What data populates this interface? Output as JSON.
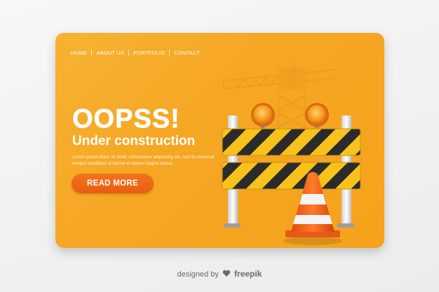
{
  "nav": {
    "items": [
      {
        "label": "HOME"
      },
      {
        "label": "ABOUT US"
      },
      {
        "label": "PORTFOLIO"
      },
      {
        "label": "CONTACT"
      }
    ]
  },
  "hero": {
    "headline": "OOPSS!",
    "subheadline": "Under construction",
    "body_text": "Lorem ipsum dolor sit amet, consectetur adipiscing elit, sed do eiusmod tempor incididunt ut labore et dolore magna aliqua.",
    "cta_label": "READ MORE"
  },
  "illustration": {
    "icons": [
      "construction-crane-icon",
      "warning-light-icon",
      "barricade-icon",
      "traffic-cone-icon"
    ]
  },
  "footer": {
    "designed_by": "designed by",
    "brand": "freepik"
  },
  "colors": {
    "card_orange": "#f5a623",
    "cta_orange": "#ee6a18",
    "stripe_black": "#2b2b2b",
    "stripe_yellow": "#f7c21b"
  }
}
